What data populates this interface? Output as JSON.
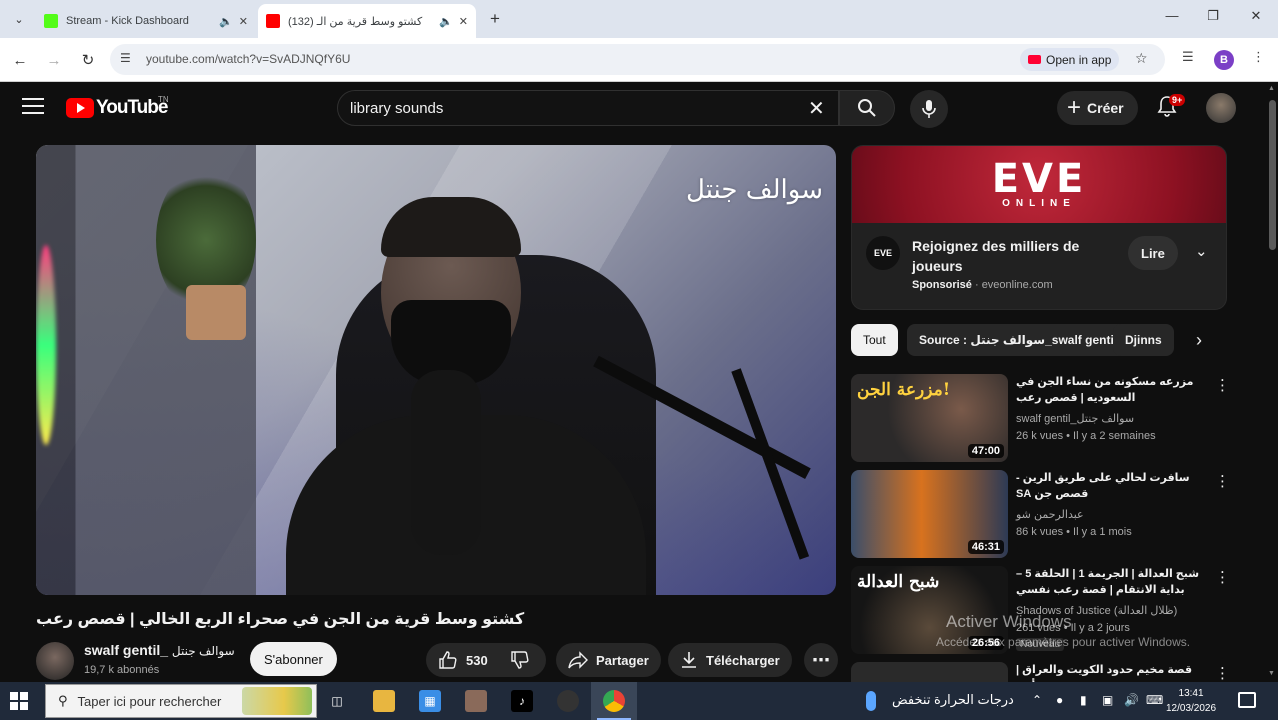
{
  "browser": {
    "tabs": [
      {
        "title": "Stream - Kick Dashboard",
        "favicon_color": "#53fc18",
        "active": false
      },
      {
        "title": "(132) كشتو وسط قرية من الـ",
        "favicon_color": "#ff0000",
        "active": true
      }
    ],
    "url": "youtube.com/watch?v=SvADJNQfY6U",
    "open_in_app": "Open in app",
    "profile_initial": "B"
  },
  "masthead": {
    "logo": "YouTube",
    "logo_tm": "TN",
    "search_value": "library sounds",
    "create_label": "Créer",
    "notif_badge": "9+"
  },
  "video": {
    "watermark": "سوالف جنتل",
    "title": "كشتو وسط قرية من الجن في صحراء الربع الخالي | قصص رعب",
    "channel_name": "swalf gentil_",
    "channel_name_arabic": "سوالف جنتل",
    "subscribers": "19,7 k abonnés",
    "subscribe_label": "S'abonner",
    "likes": "530",
    "share_label": "Partager",
    "download_label": "Télécharger"
  },
  "ad": {
    "brand": "EVE",
    "brand_sub": "ONLINE",
    "logo_text": "EVE",
    "title": "Rejoignez des milliers de joueurs",
    "sponsored": "Sponsorisé",
    "domain": "eveonline.com",
    "cta": "Lire"
  },
  "chips": [
    {
      "label": "Tout",
      "active": true
    },
    {
      "label": "Source : سوالف جنتل_swalf gentil",
      "active": false
    },
    {
      "label": "Djinns",
      "active": false
    }
  ],
  "recommendations": [
    {
      "thumb_text": "مزرعة الجن!",
      "duration": "47:00",
      "title": "مزرعه مسكونه من نساء الجن في السعوديه | قصص رعب",
      "channel": "swalf gentil_سوالف جنتل",
      "meta": "26 k vues • Il y a 2 semaines",
      "badge": ""
    },
    {
      "thumb_text": "",
      "duration": "46:31",
      "title": "سافرت لحالي على طريق الرين - قصص جن SA",
      "channel": "عبدالرحمن شو",
      "meta": "86 k vues • Il y a 1 mois",
      "badge": ""
    },
    {
      "thumb_text": "شبح العدالة",
      "duration": "26:56",
      "title": "شبح العدالة | الجريمة 1 | الحلقة 5 – بداية الانتقام | قصة رعب نفسي #رعب_نفسي",
      "channel": "Shadows of Justice (ظلال العدالة)",
      "meta": "261 vues • Il y a 2 jours",
      "badge": "Nouveau"
    },
    {
      "thumb_text": "",
      "duration": "",
      "title": "قصة مخيم حدود الكويت والعراق | قصة أثير",
      "channel": "",
      "meta": "",
      "badge": ""
    }
  ],
  "windows_activation": {
    "line1": "Activer Windows",
    "line2": "Accédez aux paramètres pour activer Windows."
  },
  "taskbar": {
    "search_placeholder": "Taper ici pour rechercher",
    "weather": "درجات الحرارة تنخفض",
    "time": "13:41",
    "date": "12/03/2026"
  }
}
